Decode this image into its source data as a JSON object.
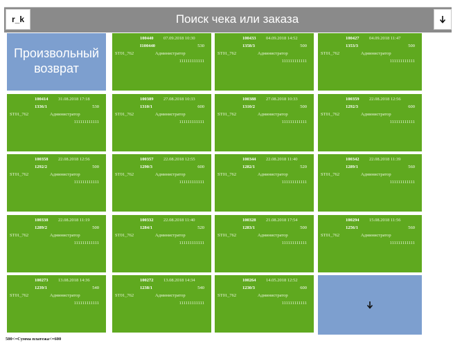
{
  "header": {
    "user_code": "r_k",
    "title": "Поиск чека или заказа"
  },
  "free_return": {
    "label_line1": "Произвольный",
    "label_line2": "возврат"
  },
  "tiles": [
    {
      "id": "100440",
      "date": "07.09.2018 10:30",
      "order": "I100440",
      "amount": "530",
      "store": "ST01_762",
      "user": "Администратор",
      "code": "111111111111"
    },
    {
      "id": "100433",
      "date": "04.09.2018 14:52",
      "order": "1358/3",
      "amount": "500",
      "store": "ST01_762",
      "user": "Администратор",
      "code": "111111111111"
    },
    {
      "id": "100427",
      "date": "04.09.2018 11:47",
      "order": "1353/3",
      "amount": "500",
      "store": "ST01_762",
      "user": "Администратор",
      "code": "111111111111"
    },
    {
      "id": "100414",
      "date": "31.08.2018 17:18",
      "order": "1336/1",
      "amount": "530",
      "store": "ST01_762",
      "user": "Администратор",
      "code": "111111111111"
    },
    {
      "id": "100389",
      "date": "27.08.2018 10:33",
      "order": "1310/1",
      "amount": "600",
      "store": "ST01_762",
      "user": "Администратор",
      "code": "111111111111"
    },
    {
      "id": "100388",
      "date": "27.08.2018 10:33",
      "order": "1310/2",
      "amount": "500",
      "store": "ST01_762",
      "user": "Администратор",
      "code": "111111111111"
    },
    {
      "id": "100359",
      "date": "22.08.2018 12:56",
      "order": "1292/3",
      "amount": "600",
      "store": "ST01_762",
      "user": "Администратор",
      "code": "111111111111"
    },
    {
      "id": "100358",
      "date": "22.08.2018 12:56",
      "order": "1292/2",
      "amount": "500",
      "store": "ST01_762",
      "user": "Администратор",
      "code": "111111111111"
    },
    {
      "id": "100357",
      "date": "22.08.2018 12:55",
      "order": "1290/3",
      "amount": "600",
      "store": "ST01_762",
      "user": "Администратор",
      "code": "111111111111"
    },
    {
      "id": "100344",
      "date": "22.08.2018 11:40",
      "order": "1282/1",
      "amount": "520",
      "store": "ST01_762",
      "user": "Администратор",
      "code": "111111111111"
    },
    {
      "id": "100342",
      "date": "22.08.2018 11:39",
      "order": "1289/1",
      "amount": "560",
      "store": "ST01_762",
      "user": "Администратор",
      "code": "111111111111"
    },
    {
      "id": "100338",
      "date": "22.08.2018 11:19",
      "order": "1289/2",
      "amount": "500",
      "store": "ST01_762",
      "user": "Администратор",
      "code": "111111111111"
    },
    {
      "id": "100332",
      "date": "22.08.2018 11:40",
      "order": "1284/1",
      "amount": "520",
      "store": "ST01_762",
      "user": "Администратор",
      "code": "111111111111"
    },
    {
      "id": "100328",
      "date": "21.08.2018 17:54",
      "order": "1283/1",
      "amount": "500",
      "store": "ST01_762",
      "user": "Администратор",
      "code": "111111111111"
    },
    {
      "id": "100294",
      "date": "15.08.2018 11:56",
      "order": "1256/1",
      "amount": "560",
      "store": "ST01_762",
      "user": "Администратор",
      "code": "111111111111"
    },
    {
      "id": "100273",
      "date": "13.08.2018 14:36",
      "order": "1239/1",
      "amount": "540",
      "store": "ST01_762",
      "user": "Администратор",
      "code": "111111111111"
    },
    {
      "id": "100272",
      "date": "13.08.2018 14:34",
      "order": "1238/1",
      "amount": "540",
      "store": "ST01_762",
      "user": "Администратор",
      "code": "111111111111"
    },
    {
      "id": "100264",
      "date": "14.05.2018 12:52",
      "order": "1230/3",
      "amount": "600",
      "store": "ST01_762",
      "user": "Администратор",
      "code": "111111111111"
    }
  ],
  "footer": {
    "filter_text": "500<=Сумма платежа<=600"
  },
  "colors": {
    "tile_green": "#5fa91f",
    "tile_blue": "#7d9fcf",
    "header_gray": "#8a8a8a"
  },
  "icons": {
    "scroll_down": "arrow-down-icon",
    "next_page": "arrow-down-icon"
  }
}
